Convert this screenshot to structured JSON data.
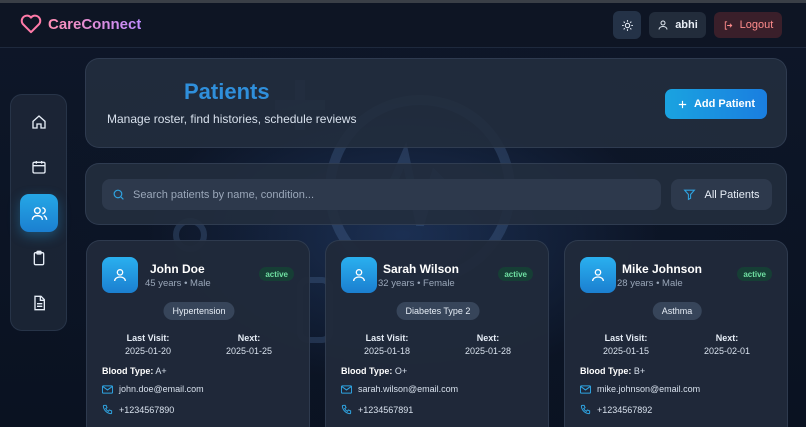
{
  "app": {
    "name": "CareConnect"
  },
  "header": {
    "user_label": "abhi",
    "logout_label": "Logout"
  },
  "sidebar": {
    "items": [
      {
        "icon": "home-icon",
        "active": false
      },
      {
        "icon": "calendar-icon",
        "active": false
      },
      {
        "icon": "users-icon",
        "active": true
      },
      {
        "icon": "clipboard-icon",
        "active": false
      },
      {
        "icon": "document-icon",
        "active": false
      }
    ]
  },
  "page": {
    "title": "Patients",
    "subtitle": "Manage roster, find histories, schedule reviews",
    "add_label": "Add Patient"
  },
  "search": {
    "placeholder": "Search patients by name, condition...",
    "filter_label": "All Patients"
  },
  "labels": {
    "last_visit": "Last Visit:",
    "next": "Next:",
    "blood_type": "Blood Type:"
  },
  "patients": [
    {
      "name": "John Doe",
      "meta": "45 years • Male",
      "status": "active",
      "condition": "Hypertension",
      "last_visit": "2025-01-20",
      "next": "2025-01-25",
      "blood": "A+",
      "email": "john.doe@email.com",
      "phone": "+1234567890"
    },
    {
      "name": "Sarah Wilson",
      "meta": "32 years • Female",
      "status": "active",
      "condition": "Diabetes Type 2",
      "last_visit": "2025-01-18",
      "next": "2025-01-28",
      "blood": "O+",
      "email": "sarah.wilson@email.com",
      "phone": "+1234567891"
    },
    {
      "name": "Mike Johnson",
      "meta": "28 years • Male",
      "status": "active",
      "condition": "Asthma",
      "last_visit": "2025-01-15",
      "next": "2025-02-01",
      "blood": "B+",
      "email": "mike.johnson@email.com",
      "phone": "+1234567892"
    }
  ]
}
